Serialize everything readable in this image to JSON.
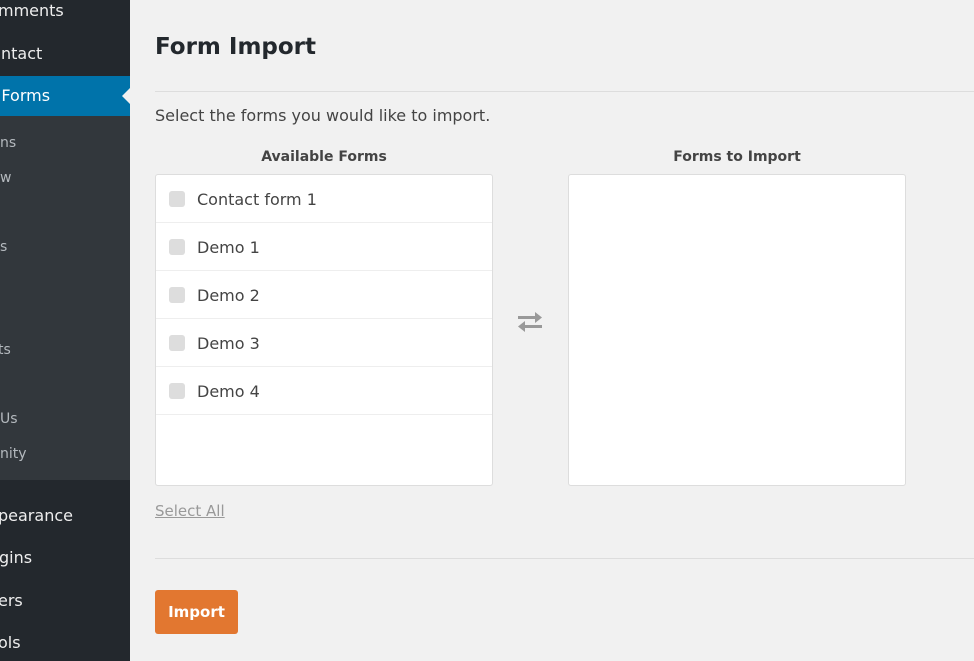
{
  "sidebar": {
    "items": [
      {
        "label": "mments"
      },
      {
        "label": "ntact"
      },
      {
        "label": "'Forms"
      },
      {
        "label": "pearance"
      },
      {
        "label": "gins"
      },
      {
        "label": "ers"
      },
      {
        "label": "ols"
      }
    ],
    "submenu": [
      {
        "label": "ns"
      },
      {
        "label": "w"
      },
      {
        "label": "s"
      },
      {
        "label": "ts"
      },
      {
        "label": "Us"
      },
      {
        "label": "nity"
      }
    ]
  },
  "main": {
    "title": "Form Import",
    "intro": "Select the forms you would like to import.",
    "available_header": "Available Forms",
    "import_header": "Forms to Import",
    "available_forms": [
      {
        "label": "Contact form 1",
        "checked": false
      },
      {
        "label": "Demo 1",
        "checked": false
      },
      {
        "label": "Demo 2",
        "checked": false
      },
      {
        "label": "Demo 3",
        "checked": false
      },
      {
        "label": "Demo 4",
        "checked": false
      }
    ],
    "forms_to_import": [],
    "swap_icon": "swap-arrows-icon",
    "select_all_label": "Select All",
    "import_label": "Import"
  },
  "colors": {
    "accent": "#0073aa",
    "import_button": "#e27730",
    "sidebar_bg": "#23282d",
    "submenu_bg": "#32373c"
  }
}
